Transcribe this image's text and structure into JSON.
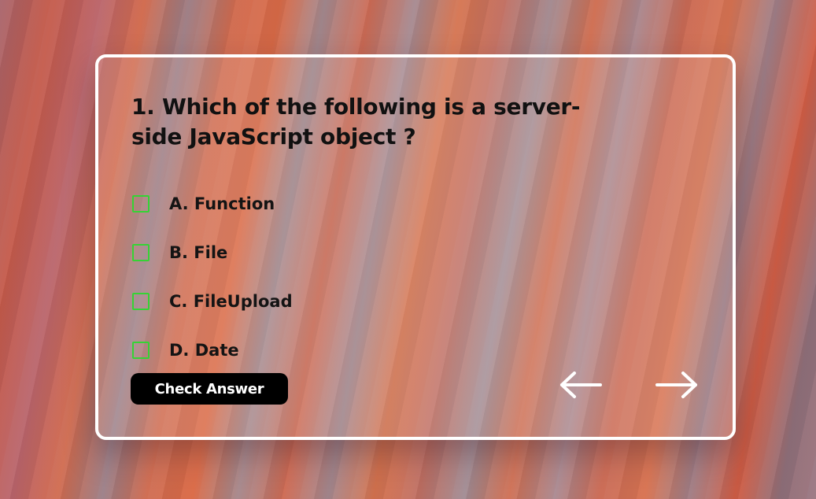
{
  "quiz": {
    "question": "1. Which of the following is a server- side JavaScript object ?",
    "options": [
      {
        "label": "A. Function",
        "checked": false
      },
      {
        "label": "B. File",
        "checked": false
      },
      {
        "label": "C. FileUpload",
        "checked": false
      },
      {
        "label": "D. Date",
        "checked": false
      }
    ],
    "check_button_label": "Check Answer",
    "nav": {
      "prev_icon": "arrow-left-icon",
      "next_icon": "arrow-right-icon"
    }
  },
  "colors": {
    "checkbox_border": "#35d335",
    "button_bg": "#000000",
    "card_border": "#ffffff"
  }
}
